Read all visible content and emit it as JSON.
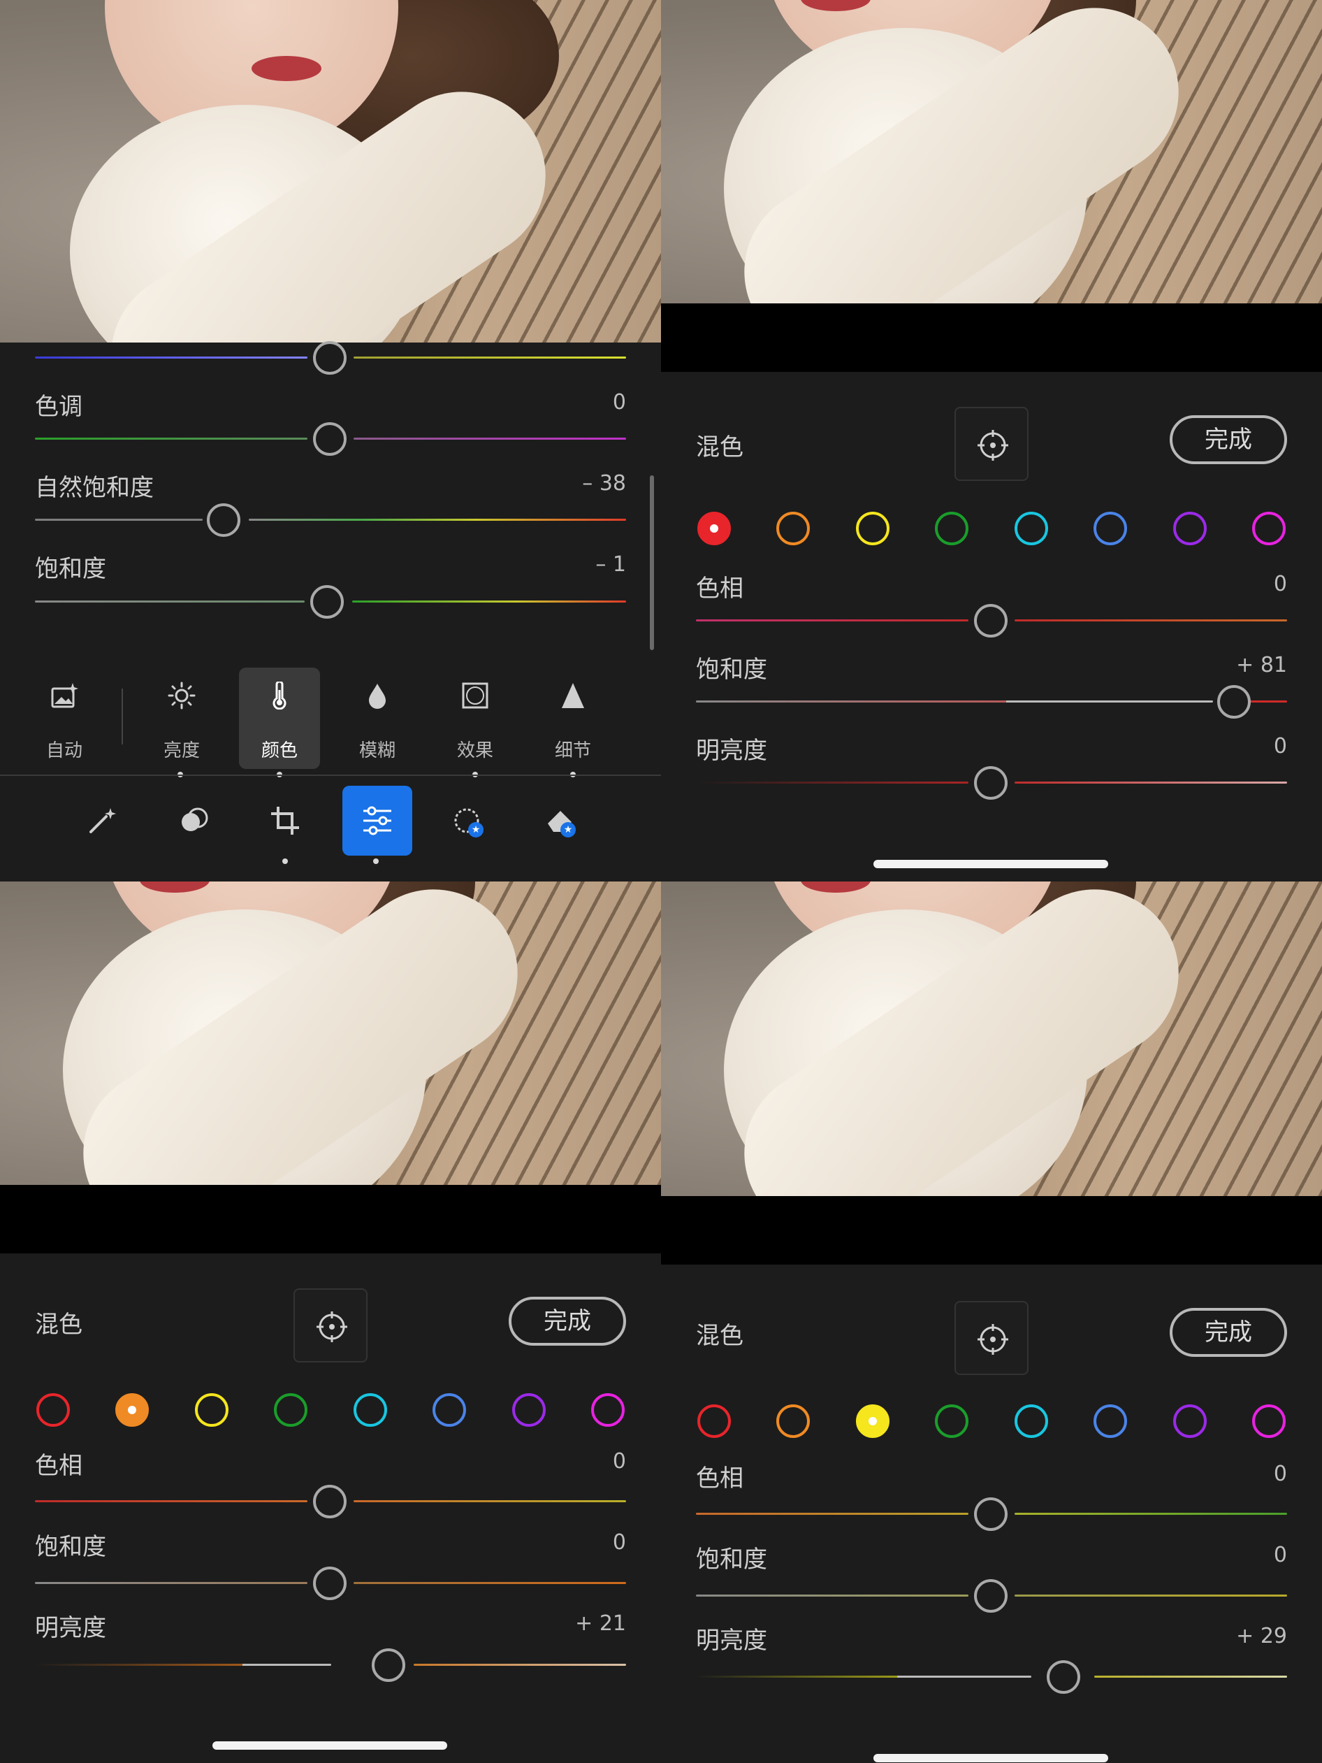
{
  "q1": {
    "sliders": [
      {
        "label": "色调",
        "value": "0"
      },
      {
        "label": "自然饱和度",
        "value": "– 38"
      },
      {
        "label": "饱和度",
        "value": "– 1"
      }
    ],
    "tools": [
      {
        "label": "自动",
        "icon": "auto-image-icon"
      },
      {
        "label": "亮度",
        "icon": "sun-icon"
      },
      {
        "label": "颜色",
        "icon": "thermometer-icon"
      },
      {
        "label": "模糊",
        "icon": "drop-icon"
      },
      {
        "label": "效果",
        "icon": "vignette-icon"
      },
      {
        "label": "细节",
        "icon": "triangle-icon"
      }
    ],
    "selected_tool": "颜色",
    "bottom_bar": [
      "magic-wand-icon",
      "mask-icon",
      "crop-icon",
      "sliders-icon",
      "selective-icon",
      "eraser-icon"
    ]
  },
  "mix_title": "混色",
  "done_label": "完成",
  "colors": [
    "#e8252b",
    "#f08a24",
    "#f5e61e",
    "#1a9e2b",
    "#19c6e0",
    "#4a84e8",
    "#9b2ae8",
    "#e822e0"
  ],
  "q2": {
    "selected_color": 0,
    "sliders": [
      {
        "label": "色相",
        "value": "0"
      },
      {
        "label": "饱和度",
        "value": "+ 81"
      },
      {
        "label": "明亮度",
        "value": "0"
      }
    ]
  },
  "q3": {
    "selected_color": 1,
    "sliders": [
      {
        "label": "色相",
        "value": "0"
      },
      {
        "label": "饱和度",
        "value": "0"
      },
      {
        "label": "明亮度",
        "value": "+ 21"
      }
    ]
  },
  "q4": {
    "selected_color": 2,
    "sliders": [
      {
        "label": "色相",
        "value": "0"
      },
      {
        "label": "饱和度",
        "value": "0"
      },
      {
        "label": "明亮度",
        "value": "+ 29"
      }
    ]
  }
}
